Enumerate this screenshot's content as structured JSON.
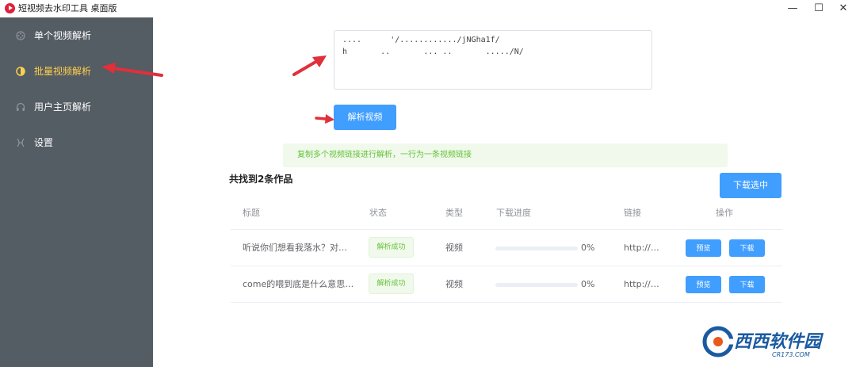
{
  "window": {
    "title": "短视频去水印工具 桌面版",
    "minimize": "—",
    "maximize": "☐",
    "close": "✕"
  },
  "sidebar": {
    "items": [
      {
        "label": "单个视频解析",
        "icon": "film-reel-icon",
        "active": false
      },
      {
        "label": "批量视频解析",
        "icon": "half-circle-icon",
        "active": true
      },
      {
        "label": "用户主页解析",
        "icon": "headphones-icon",
        "active": false
      },
      {
        "label": "设置",
        "icon": "settings-icon",
        "active": false
      }
    ],
    "bg_color": "#545c64",
    "active_color": "#ffd04b"
  },
  "input": {
    "value": "....      '/............/jNGha1f/\nh       ..       ... ..       ...../N/"
  },
  "parse_button": "解析视频",
  "tip": "复制多个视频链接进行解析，一行为一条视频链接",
  "result": {
    "found_text": "共找到2条作品",
    "download_selected": "下载选中"
  },
  "table": {
    "headers": [
      "标题",
      "状态",
      "类型",
      "下载进度",
      "链接",
      "操作"
    ],
    "rows": [
      {
        "title": "听说你们想看我落水？对…",
        "status": "解析成功",
        "type": "视频",
        "progress": 0,
        "progress_text": "0%",
        "link": "http://…",
        "preview": "预览",
        "download": "下载"
      },
      {
        "title": "come的喂到底是什么意思…",
        "status": "解析成功",
        "type": "视频",
        "progress": 0,
        "progress_text": "0%",
        "link": "http://…",
        "preview": "预览",
        "download": "下载"
      }
    ]
  },
  "watermark": {
    "text": "西西软件园",
    "sub": "CR173.COM"
  },
  "colors": {
    "primary": "#409eff",
    "success": "#67c23a",
    "annotation_arrow": "#e0303a"
  }
}
